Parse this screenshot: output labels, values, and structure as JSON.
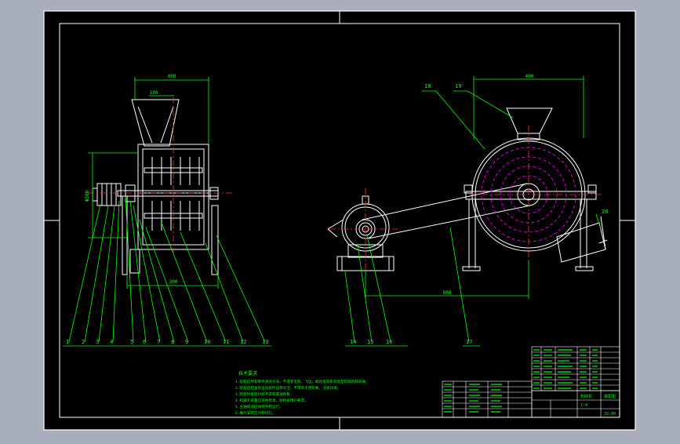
{
  "colors": {
    "app_background": "#a8aebb",
    "drawing_background": "#000000",
    "frame": "#ffffff",
    "geometry": "#ffffff",
    "dimension": "#00ff00",
    "hidden_circle": "#ff00ff",
    "centerline": "#ff3030"
  },
  "dimensions": {
    "front_top_width": "400",
    "front_hopper_width": "100",
    "front_pulley_diameter": "Φ380",
    "front_bottom_width": "300",
    "side_top_width": "400",
    "side_bottom_width": "800"
  },
  "callouts": {
    "front": [
      "1",
      "2",
      "3",
      "4",
      "5",
      "6",
      "7",
      "8",
      "9",
      "10",
      "11",
      "12",
      "13"
    ],
    "side_bottom": [
      "14",
      "15",
      "16",
      "17"
    ],
    "side_top": [
      "18",
      "19"
    ],
    "side_right": "20"
  },
  "technical_notes": {
    "title": "技术要求",
    "lines": [
      "1.装配前所有零件清洗干净，不得有毛刺、飞边、氧化皮等影响装配的缺陷和杂质。",
      "2.装配后检查各运动部件运转灵活，不得有卡阻现象，注意润滑。",
      "3.装配时各密封处不得有漏油现象。",
      "4.机器外表面应涂防锈漆，颜色按用户要求。",
      "5.主轴转速应保持平稳运行。",
      "6.锤片安装应对称均匀。"
    ]
  },
  "title_block": {
    "drawing_name": "粉碎机",
    "scale": "1:4",
    "drawing_number": "JS-00",
    "assembly_label": "装配图"
  }
}
